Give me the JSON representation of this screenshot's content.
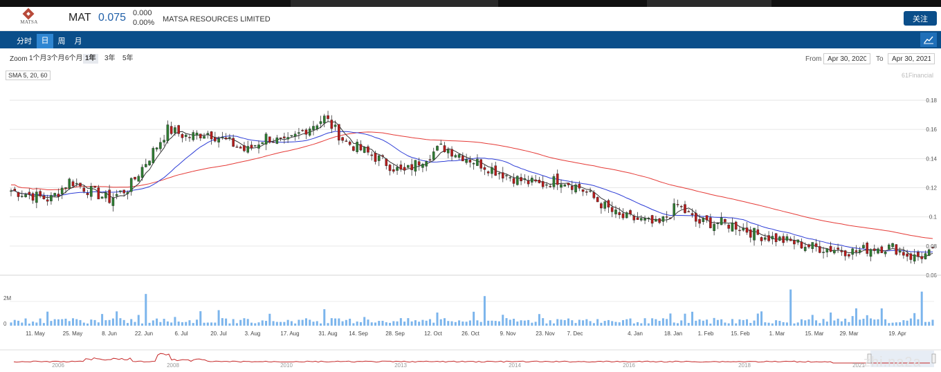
{
  "header": {
    "logo_text": "MATSA",
    "ticker": "MAT",
    "price": "0.075",
    "change": "0.000",
    "change_pct": "0.00%",
    "company": "MATSA RESOURCES LIMITED",
    "follow_label": "关注"
  },
  "nav": {
    "tabs": [
      {
        "label": "分时",
        "active": false
      },
      {
        "label": "日",
        "active": true
      },
      {
        "label": "周",
        "active": false
      },
      {
        "label": "月",
        "active": false
      }
    ]
  },
  "toolbar": {
    "zoom_label": "Zoom",
    "zoom_options": [
      {
        "label": "1个月",
        "active": false
      },
      {
        "label": "3个月",
        "active": false
      },
      {
        "label": "6个月",
        "active": false
      },
      {
        "label": "1年",
        "active": true
      },
      {
        "label": "3年",
        "active": false
      },
      {
        "label": "5年",
        "active": false
      }
    ],
    "from_label": "From",
    "from_value": "Apr 30, 2020",
    "to_label": "To",
    "to_value": "Apr 30, 2021"
  },
  "indicator_label": "SMA 5, 20, 60",
  "credit": "61Financial",
  "watermark": "zhi.na2a",
  "colors": {
    "up": "#2e7d32",
    "down": "#b71c1c",
    "sma5": "#333333",
    "sma20": "#2b3bd6",
    "sma60": "#e53935",
    "volume": "#7cb5ec",
    "nav": "#0a4e8a"
  },
  "chart_data": {
    "type": "candlestick",
    "y_ticks": [
      "0.18",
      "0.16",
      "0.14",
      "0.12",
      "0.1",
      "0.08",
      "0.06"
    ],
    "ylim": [
      0.06,
      0.18
    ],
    "x_ticks": [
      "11. May",
      "25. May",
      "8. Jun",
      "22. Jun",
      "6. Jul",
      "20. Jul",
      "3. Aug",
      "17. Aug",
      "31. Aug",
      "14. Sep",
      "28. Sep",
      "12. Oct",
      "26. Oct",
      "9. Nov",
      "23. Nov",
      "7. Dec",
      "4. Jan",
      "18. Jan",
      "1. Feb",
      "15. Feb",
      "1. Mar",
      "15. Mar",
      "29. Mar",
      "19. Apr"
    ],
    "volume_ticks": [
      "2M",
      "0"
    ],
    "volume_max": 2000000,
    "navigator_ticks": [
      "2006",
      "2008",
      "2010",
      "2013",
      "2014",
      "2016",
      "2018",
      "2021"
    ],
    "price_anchors": [
      0.118,
      0.115,
      0.112,
      0.125,
      0.118,
      0.112,
      0.12,
      0.14,
      0.16,
      0.155,
      0.158,
      0.152,
      0.145,
      0.155,
      0.15,
      0.16,
      0.168,
      0.152,
      0.145,
      0.138,
      0.13,
      0.14,
      0.148,
      0.142,
      0.136,
      0.13,
      0.125,
      0.122,
      0.126,
      0.12,
      0.11,
      0.1,
      0.098,
      0.094,
      0.108,
      0.096,
      0.096,
      0.094,
      0.088,
      0.085,
      0.082,
      0.079,
      0.078,
      0.076,
      0.079,
      0.079,
      0.072,
      0.075
    ],
    "candle_count": 254
  }
}
